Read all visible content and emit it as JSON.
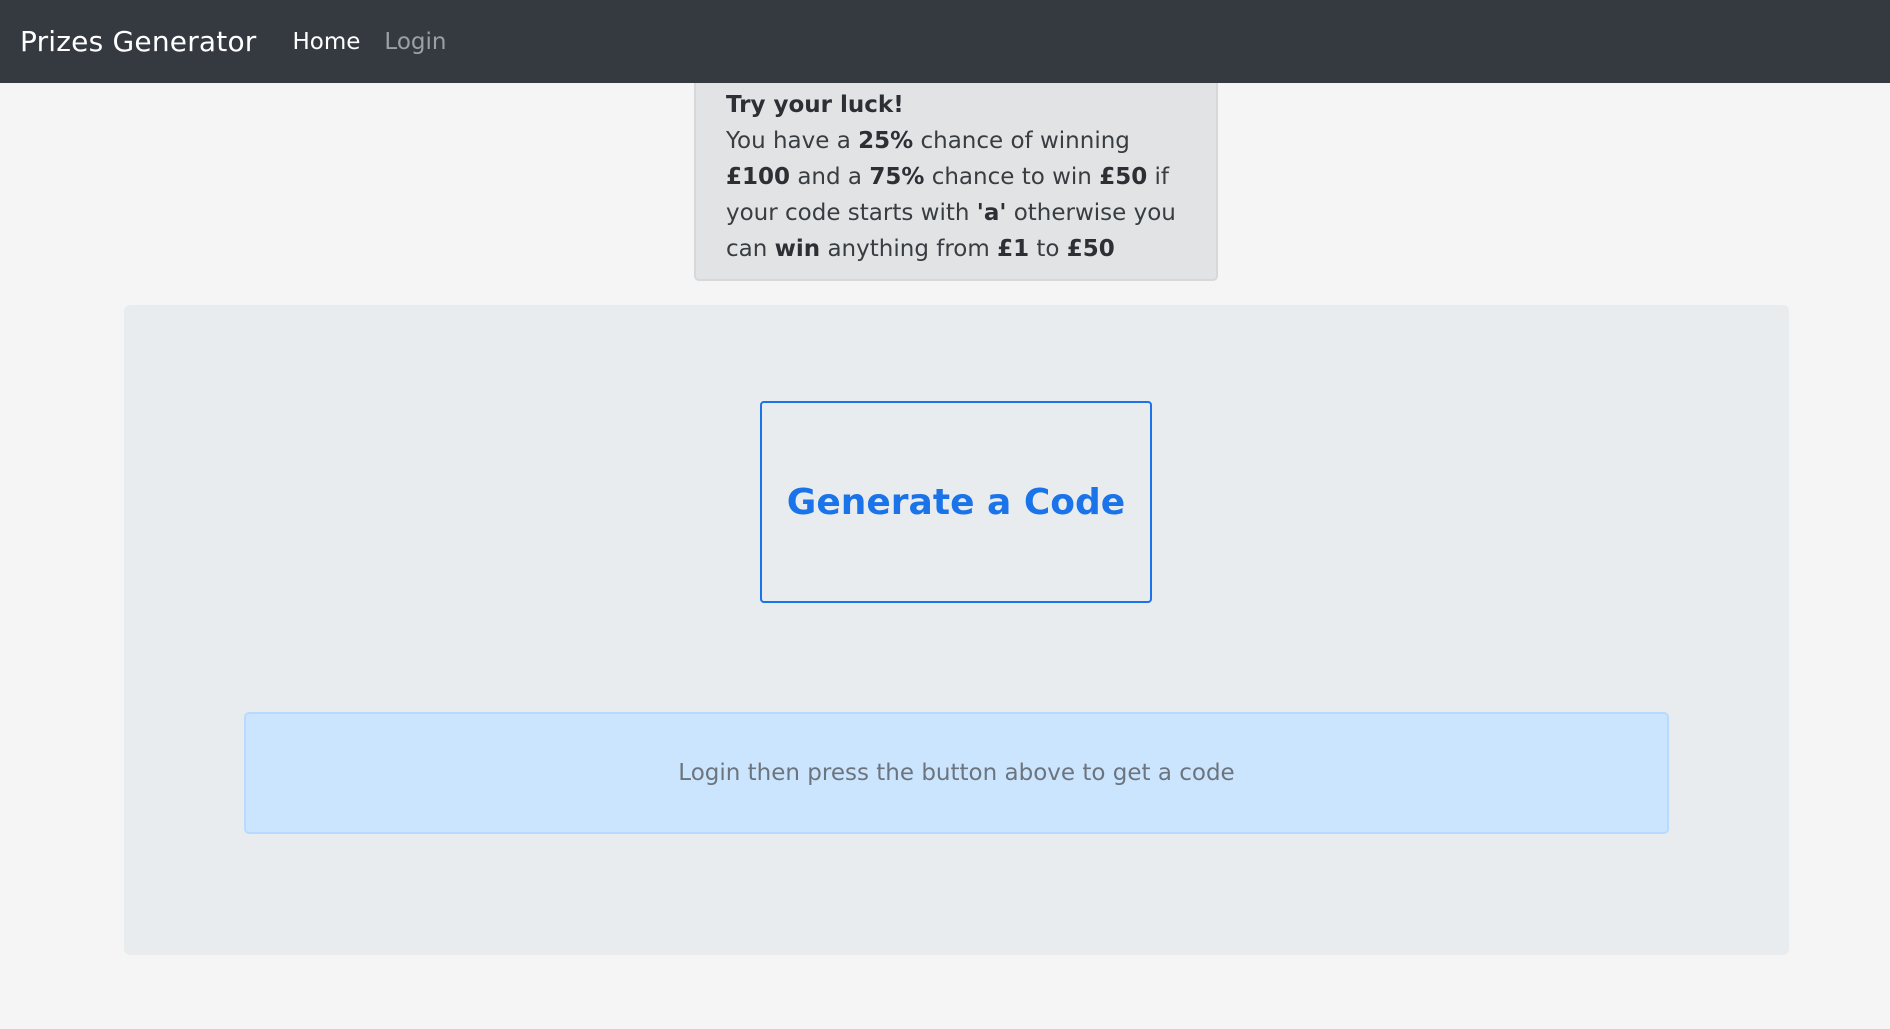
{
  "navbar": {
    "brand": "Prizes Generator",
    "links": [
      {
        "label": "Home",
        "active": true
      },
      {
        "label": "Login",
        "active": false
      }
    ]
  },
  "info_card": {
    "title": "Try your luck!",
    "segments": [
      {
        "text": "You have a ",
        "bold": false
      },
      {
        "text": "25%",
        "bold": true
      },
      {
        "text": " chance of winning ",
        "bold": false
      },
      {
        "text": "£100",
        "bold": true
      },
      {
        "text": " and a ",
        "bold": false
      },
      {
        "text": "75%",
        "bold": true
      },
      {
        "text": " chance to win ",
        "bold": false
      },
      {
        "text": "£50",
        "bold": true
      },
      {
        "text": " if your code starts with ",
        "bold": false
      },
      {
        "text": "'a'",
        "bold": true
      },
      {
        "text": " otherwise you can ",
        "bold": false
      },
      {
        "text": "win",
        "bold": true
      },
      {
        "text": " anything from ",
        "bold": false
      },
      {
        "text": "£1",
        "bold": true
      },
      {
        "text": " to ",
        "bold": false
      },
      {
        "text": "£50",
        "bold": true
      }
    ]
  },
  "main": {
    "generate_button_label": "Generate a Code",
    "alert_text": "Login then press the button above to get a code"
  },
  "colors": {
    "navbar_bg": "#343a40",
    "primary": "#1a73e8",
    "alert_bg": "#cce5ff",
    "jumbotron_bg": "#e9ecef"
  }
}
